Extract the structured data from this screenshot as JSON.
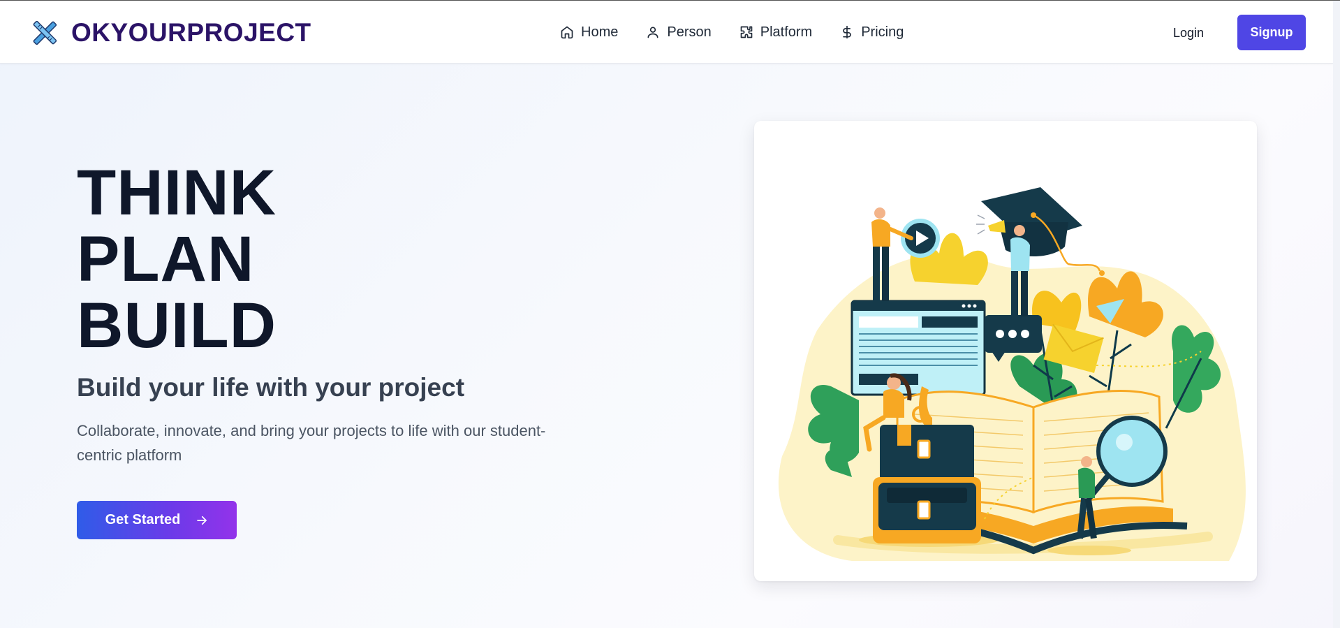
{
  "brand": {
    "name": "OKYOURPROJECT",
    "logo_icon": "crossed-tools-icon",
    "color": "#2b1367"
  },
  "nav": {
    "items": [
      {
        "label": "Home",
        "icon": "home-icon"
      },
      {
        "label": "Person",
        "icon": "person-icon"
      },
      {
        "label": "Platform",
        "icon": "puzzle-icon"
      },
      {
        "label": "Pricing",
        "icon": "dollar-icon"
      }
    ]
  },
  "auth": {
    "login_label": "Login",
    "signup_label": "Signup",
    "signup_color": "#4f46e5"
  },
  "hero": {
    "title_lines": [
      "THINK",
      "PLAN",
      "BUILD"
    ],
    "subtitle": "Build your life with your project",
    "description": "Collaborate, innovate, and bring your projects to life with our student-centric platform",
    "cta_label": "Get Started",
    "cta_icon": "arrow-right-icon"
  },
  "illustration": {
    "subject": "education-illustration"
  }
}
